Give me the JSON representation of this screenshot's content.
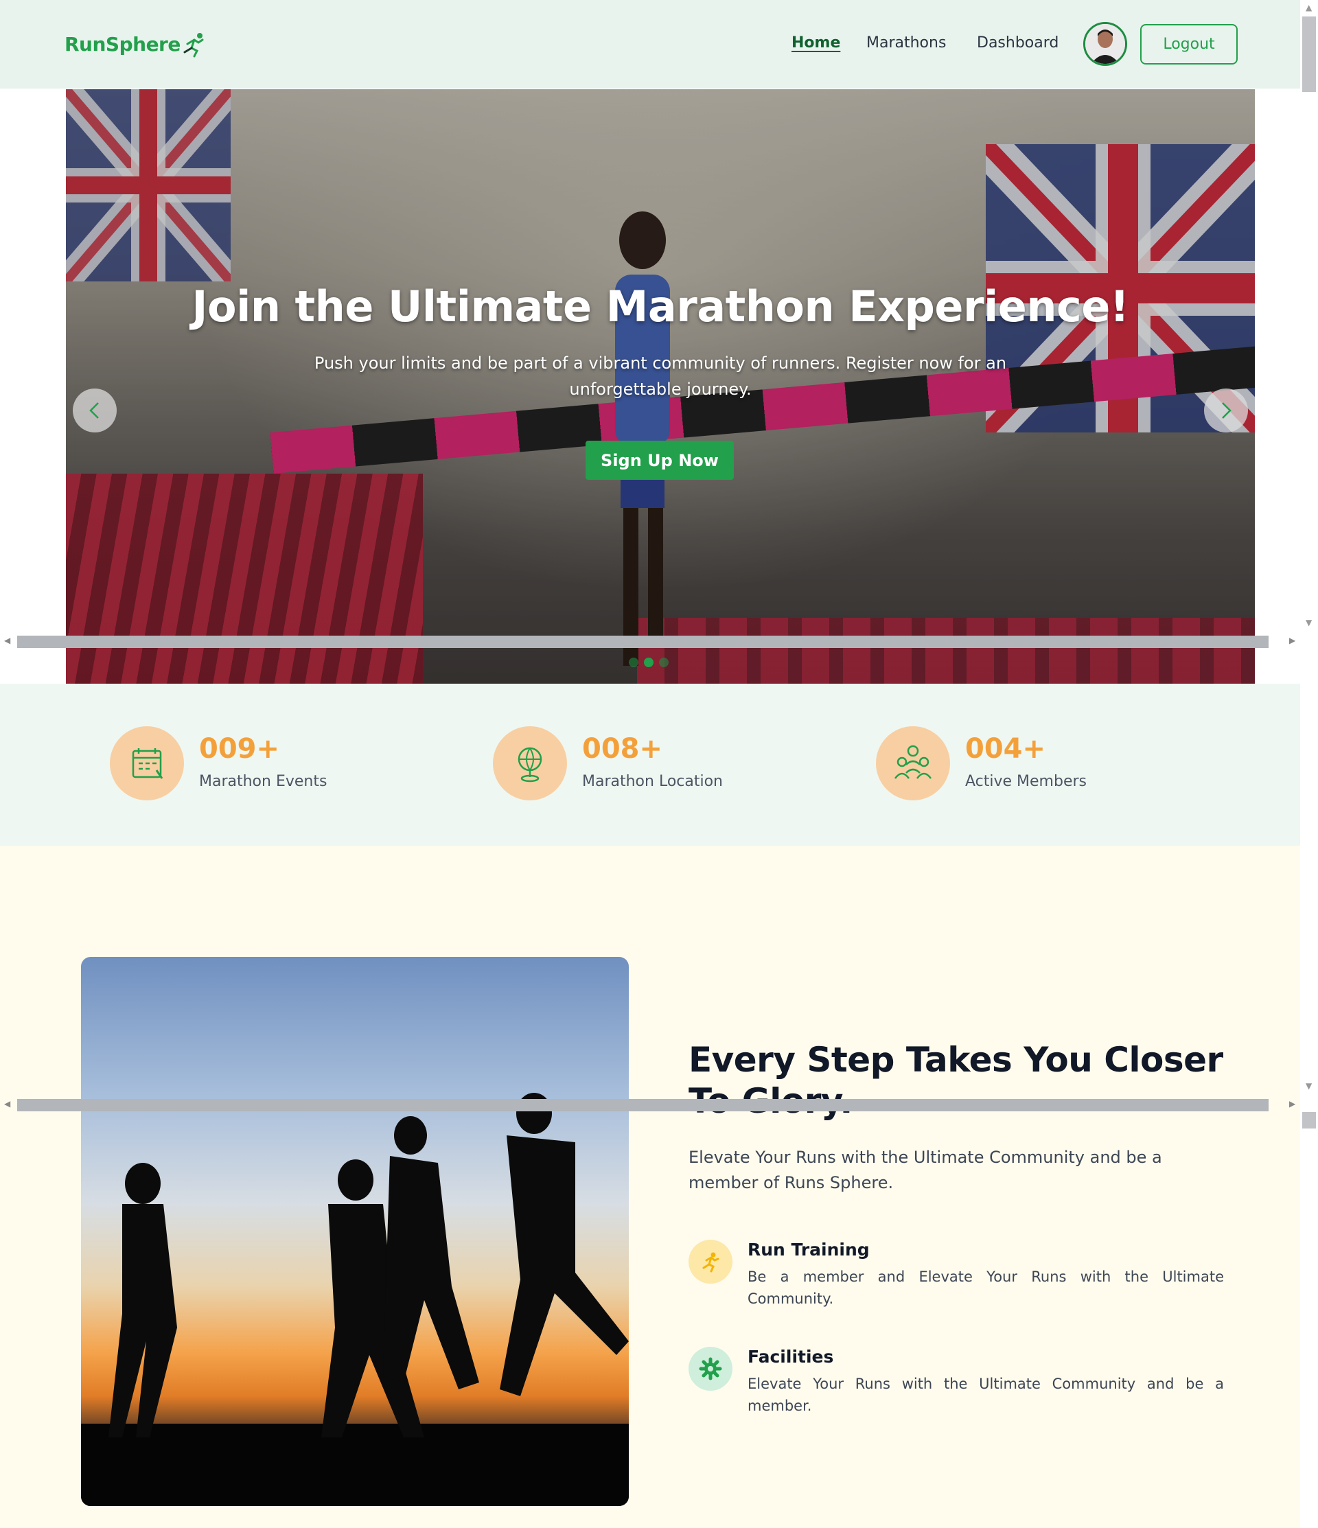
{
  "brand": {
    "name": "RunSphere",
    "primary": "#22a04b",
    "accent": "#f4a03a"
  },
  "nav": {
    "links": [
      {
        "label": "Home",
        "active": true
      },
      {
        "label": "Marathons",
        "active": false
      },
      {
        "label": "Dashboard",
        "active": false
      }
    ],
    "avatar_icon": "user-avatar",
    "logout_label": "Logout"
  },
  "hero": {
    "title": "Join the Ultimate Marathon Experience!",
    "subtitle": "Push your limits and be part of a vibrant community of runners. Register now for an unforgettable journey.",
    "cta_label": "Sign Up Now",
    "prev_icon": "chevron-left-icon",
    "next_icon": "chevron-right-icon",
    "slides_total": 3,
    "active_slide": 1
  },
  "stats": [
    {
      "value": "009+",
      "label": "Marathon Events",
      "icon": "calendar-icon"
    },
    {
      "value": "008+",
      "label": "Marathon Location",
      "icon": "location-globe-icon"
    },
    {
      "value": "004+",
      "label": "Active Members",
      "icon": "members-icon"
    }
  ],
  "feature": {
    "title": "Every Step Takes You Closer To Glory.",
    "description": "Elevate Your Runs with the Ultimate Community and be a member of Runs Sphere.",
    "items": [
      {
        "title": "Run Training",
        "description": "Be a member and Elevate Your Runs with the Ultimate Community.",
        "icon": "runner-icon",
        "color": "#fde8a8"
      },
      {
        "title": "Facilities",
        "description": "Elevate Your Runs with the Ultimate Community and be a member.",
        "icon": "gear-icon",
        "color": "#cfeedb"
      }
    ]
  }
}
